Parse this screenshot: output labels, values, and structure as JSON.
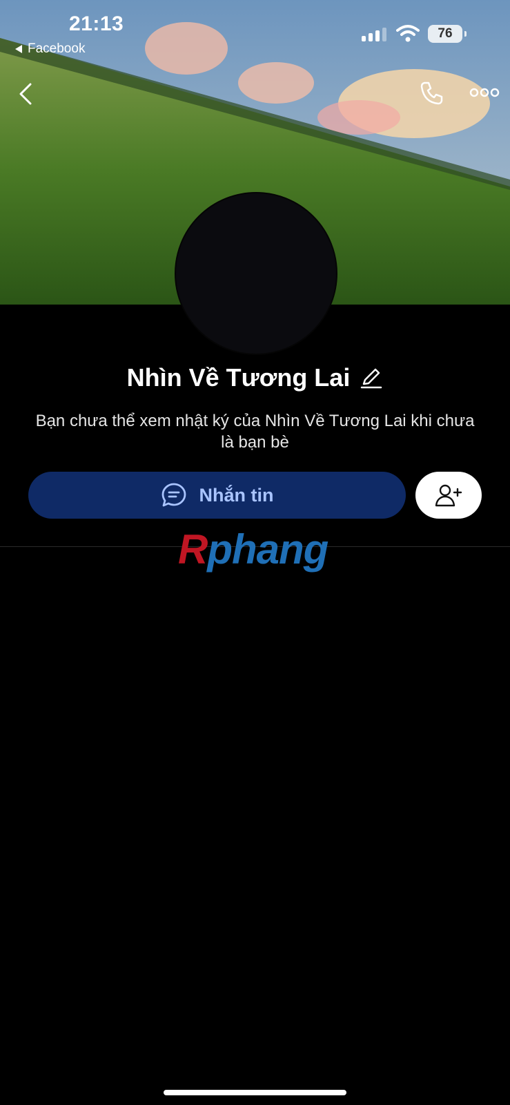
{
  "status_bar": {
    "time": "21:13",
    "back_app": "Facebook",
    "battery": "76"
  },
  "profile": {
    "name": "Nhìn Về Tương Lai",
    "notice": "Bạn chưa thể xem nhật ký của Nhìn Về Tương Lai khi chưa là bạn bè"
  },
  "actions": {
    "message_label": "Nhắn tin",
    "message_icon": "chat-bubble-icon",
    "add_friend_icon": "add-friend-icon"
  },
  "header_icons": [
    "back-arrow-icon",
    "phone-icon",
    "more-icon"
  ],
  "watermark": {
    "part1": "R",
    "part2": "phang"
  },
  "colors": {
    "background": "#000000",
    "message_button": "#0f2a66",
    "message_text": "#a9c4ff",
    "add_button": "#ffffff"
  }
}
